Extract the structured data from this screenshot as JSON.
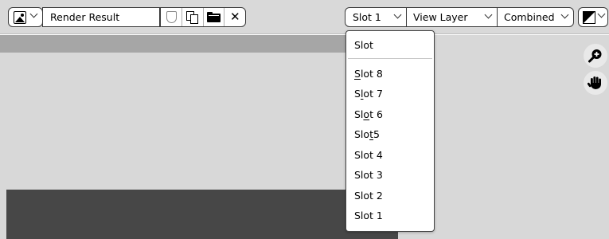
{
  "header": {
    "render_name": "Render Result",
    "slot_select": "Slot 1",
    "layer_select": "View Layer",
    "pass_select": "Combined",
    "icons": {
      "editor_type": "image-editor-icon",
      "fake_user": "shield-icon",
      "duplicate": "duplicate-icon",
      "browse": "folder-icon",
      "unlink": "close-icon",
      "display": "display-channels-icon"
    }
  },
  "slot_menu": {
    "title": "Slot",
    "items": [
      {
        "pre": "",
        "ul": "S",
        "post": "lot 8"
      },
      {
        "pre": "S",
        "ul": "l",
        "post": "ot 7"
      },
      {
        "pre": "Sl",
        "ul": "o",
        "post": "t 6"
      },
      {
        "pre": "Slo",
        "ul": "t",
        "post": " 5"
      },
      {
        "pre": "",
        "ul": "",
        "post": "Slot 4"
      },
      {
        "pre": "",
        "ul": "",
        "post": "Slot 3"
      },
      {
        "pre": "",
        "ul": "",
        "post": "Slot 2"
      },
      {
        "pre": "",
        "ul": "",
        "post": "Slot 1"
      }
    ]
  },
  "navigation": {
    "zoom": "zoom-icon",
    "pan": "hand-icon"
  }
}
